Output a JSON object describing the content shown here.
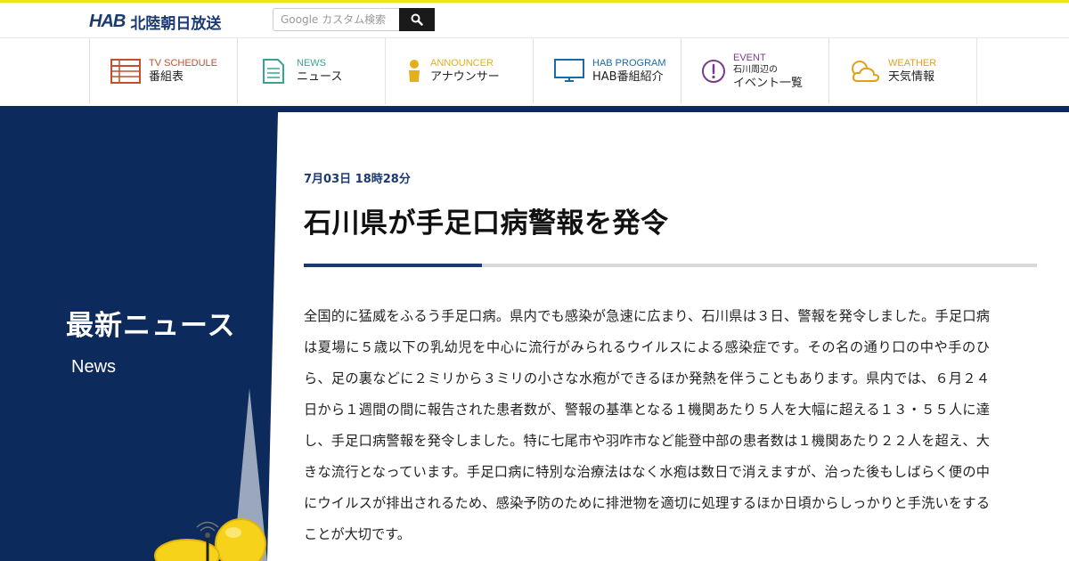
{
  "header": {
    "logo_mark": "HAB",
    "logo_name": "北陸朝日放送",
    "search_placeholder": "Google カスタム検索",
    "search_icon": "search-icon"
  },
  "nav": {
    "items": [
      {
        "en": "TV SCHEDULE",
        "ja": "番組表",
        "icon": "tv-schedule-icon",
        "color": "#c1502e"
      },
      {
        "en": "NEWS",
        "ja": "ニュース",
        "icon": "news-document-icon",
        "color": "#3aa58f"
      },
      {
        "en": "ANNOUNCER",
        "ja": "アナウンサー",
        "icon": "person-icon",
        "color": "#e3b01b"
      },
      {
        "en": "HAB PROGRAM",
        "ja": "HAB番組紹介",
        "icon": "monitor-icon",
        "color": "#1b6aa8"
      },
      {
        "en": "EVENT",
        "ja_small": "石川周辺の",
        "ja": "イベント一覧",
        "icon": "exclamation-circle-icon",
        "color": "#7b3b8c"
      },
      {
        "en": "WEATHER",
        "ja": "天気情報",
        "icon": "weather-cloud-icon",
        "color": "#e0a11c"
      }
    ]
  },
  "section": {
    "title": "最新ニュース",
    "subtitle": "News"
  },
  "article": {
    "date": "7月03日 18時28分",
    "headline": "石川県が手足口病警報を発令",
    "body": "全国的に猛威をふるう手足口病。県内でも感染が急速に広まり、石川県は３日、警報を発令しました。手足口病は夏場に５歳以下の乳幼児を中心に流行がみられるウイルスによる感染症です。その名の通り口の中や手のひら、足の裏などに２ミリから３ミリの小さな水疱ができるほか発熱を伴うこともあります。県内では、６月２４日から１週間の間に報告された患者数が、警報の基準となる１機関あたり５人を大幅に超える１３・５５人に達し、手足口病警報を発令しました。特に七尾市や羽咋市など能登中部の患者数は１機関あたり２２人を超え、大きな流行となっています。手足口病に特別な治療法はなく水疱は数日で消えますが、治った後もしばらく便の中にウイルスが排出されるため、感染予防のために排泄物を適切に処理するほか日頃からしっかりと手洗いをすることが大切です。"
  },
  "colors": {
    "navy": "#0c2a5c",
    "accent_yellow": "#f2e21b",
    "brand_blue": "#1b3a72"
  }
}
